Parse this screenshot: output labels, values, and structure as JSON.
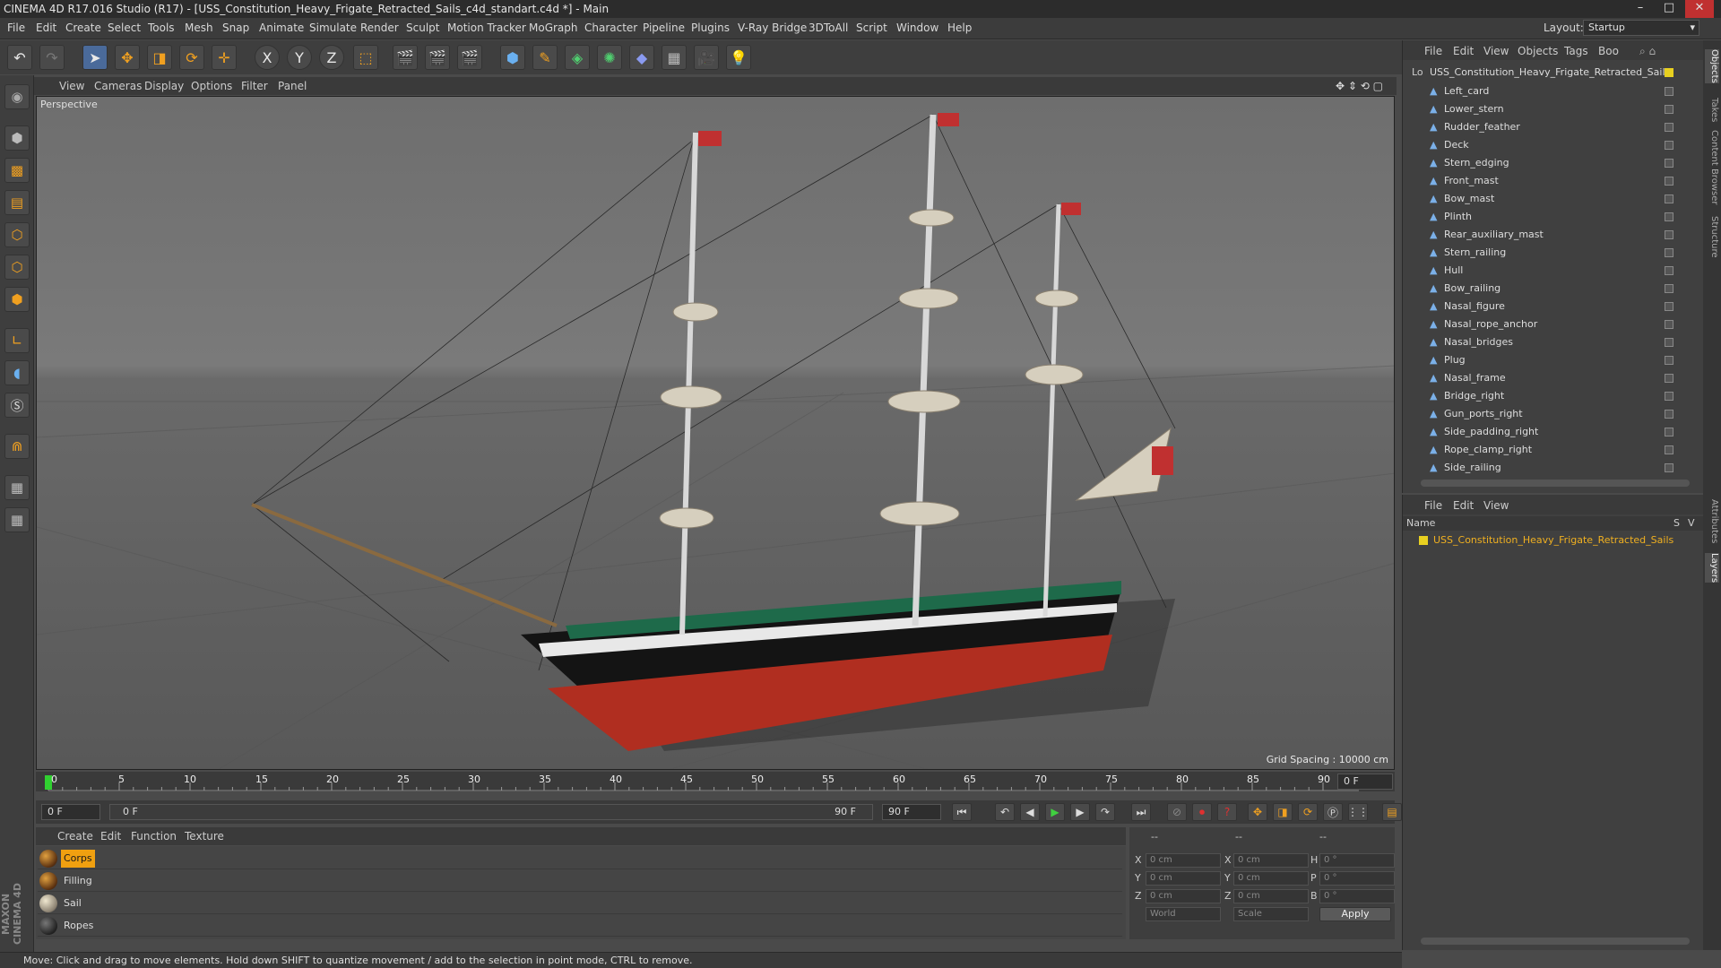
{
  "window": {
    "title": "CINEMA 4D R17.016 Studio (R17) - [USS_Constitution_Heavy_Frigate_Retracted_Sails_c4d_standart.c4d *] - Main",
    "min": "–",
    "max": "□",
    "close": "✕"
  },
  "menu": [
    "File",
    "Edit",
    "Create",
    "Select",
    "Tools",
    "Mesh",
    "Snap",
    "Animate",
    "Simulate",
    "Render",
    "Sculpt",
    "Motion Tracker",
    "MoGraph",
    "Character",
    "Pipeline",
    "Plugins",
    "V-Ray Bridge",
    "3DToAll",
    "Script",
    "Window",
    "Help"
  ],
  "layout": {
    "label": "Layout:",
    "value": "Startup"
  },
  "toolbar": {
    "undo": "↶",
    "redo": "↷",
    "x": "X",
    "y": "Y",
    "z": "Z"
  },
  "viewport": {
    "menu": [
      "View",
      "Cameras",
      "Display",
      "Options",
      "Filter",
      "Panel"
    ],
    "label": "Perspective",
    "grid_spacing": "Grid Spacing : 10000 cm"
  },
  "timeline": {
    "ticks": [
      "0",
      "5",
      "10",
      "15",
      "20",
      "25",
      "30",
      "35",
      "40",
      "45",
      "50",
      "55",
      "60",
      "65",
      "70",
      "75",
      "80",
      "85",
      "90"
    ],
    "frame_field": "0 F"
  },
  "transport": {
    "start": "0 F",
    "range_start": "0 F",
    "range_end": "90 F",
    "end": "90 F"
  },
  "materials": {
    "menu": [
      "Create",
      "Edit",
      "Function",
      "Texture"
    ],
    "items": [
      "Corps",
      "Filling",
      "Sail",
      "Ropes"
    ]
  },
  "coords": {
    "header1": "--",
    "header2": "--",
    "header3": "--",
    "rows": [
      {
        "a": "X",
        "av": "0 cm",
        "b": "X",
        "bv": "0 cm",
        "c": "H",
        "cv": "0 °"
      },
      {
        "a": "Y",
        "av": "0 cm",
        "b": "Y",
        "bv": "0 cm",
        "c": "P",
        "cv": "0 °"
      },
      {
        "a": "Z",
        "av": "0 cm",
        "b": "Z",
        "bv": "0 cm",
        "c": "B",
        "cv": "0 °"
      }
    ],
    "world": "World",
    "scale": "Scale",
    "apply": "Apply"
  },
  "status": "Move: Click and drag to move elements. Hold down SHIFT to quantize movement / add to the selection in point mode, CTRL to remove.",
  "objects": {
    "menu": [
      "File",
      "Edit",
      "View",
      "Objects",
      "Tags",
      "Boo"
    ],
    "root": "USS_Constitution_Heavy_Frigate_Retracted_Sails",
    "items": [
      "Left_card",
      "Lower_stern",
      "Rudder_feather",
      "Deck",
      "Stern_edging",
      "Front_mast",
      "Bow_mast",
      "Plinth",
      "Rear_auxiliary_mast",
      "Stern_railing",
      "Hull",
      "Bow_railing",
      "Nasal_figure",
      "Nasal_rope_anchor",
      "Nasal_bridges",
      "Plug",
      "Nasal_frame",
      "Bridge_right",
      "Gun_ports_right",
      "Side_padding_right",
      "Rope_clamp_right",
      "Side_railing"
    ]
  },
  "layers": {
    "menu": [
      "File",
      "Edit",
      "View"
    ],
    "col_name": "Name",
    "col_s": "S",
    "col_v": "V",
    "item": "USS_Constitution_Heavy_Frigate_Retracted_Sails"
  },
  "sidetabs": [
    "Objects",
    "Takes",
    "Content Browser",
    "Structure",
    "Attributes",
    "Layers"
  ],
  "brand": "MAXON CINEMA 4D"
}
